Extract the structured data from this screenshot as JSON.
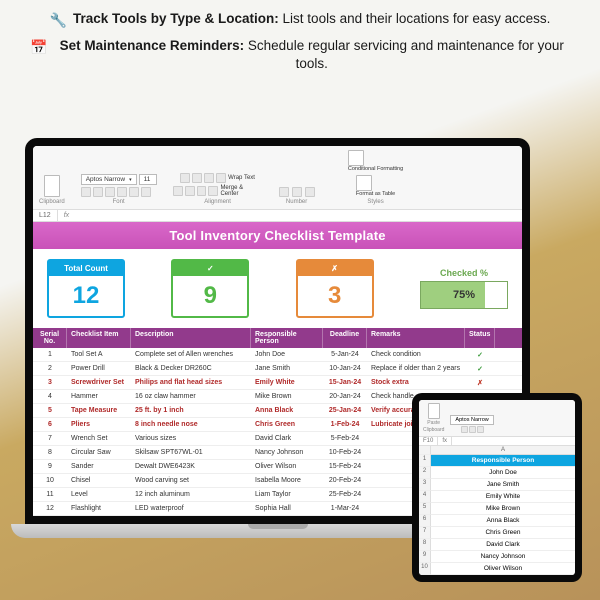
{
  "promo": {
    "line1_bold": "Track Tools by Type & Location:",
    "line1_rest": "List tools and their locations for easy access.",
    "line2_bold": "Set Maintenance Reminders:",
    "line2_rest": "Schedule regular servicing and maintenance for your tools."
  },
  "ribbon": {
    "font_name": "Aptos Narrow",
    "font_size": "11",
    "groups": {
      "clipboard": "Clipboard",
      "font": "Font",
      "alignment": "Alignment",
      "number": "Number",
      "styles": "Styles"
    },
    "wrap_text": "Wrap Text",
    "merge_center": "Merge & Center",
    "cond_fmt": "Conditional Formatting",
    "fmt_table": "Format as Table"
  },
  "cellref": {
    "cell": "L12",
    "fx": "fx"
  },
  "sheet": {
    "title": "Tool Inventory Checklist Template",
    "stats": {
      "total_label": "Total Count",
      "total_value": "12",
      "checked_mark": "✓",
      "checked_value": "9",
      "unchecked_mark": "✗",
      "unchecked_value": "3",
      "pct_label": "Checked %",
      "pct_value": "75%",
      "pct_fill": 75
    },
    "columns": {
      "serial": "Serial No.",
      "item": "Checklist Item",
      "desc": "Description",
      "person": "Responsible Person",
      "deadline": "Deadline",
      "remarks": "Remarks",
      "status": "Status"
    },
    "rows": [
      {
        "n": "1",
        "item": "Tool Set A",
        "desc": "Complete set of Allen wrenches",
        "person": "John Doe",
        "dead": "5-Jan-24",
        "rem": "Check condition",
        "stat": "✓",
        "red": false,
        "ok": true
      },
      {
        "n": "2",
        "item": "Power Drill",
        "desc": "Black & Decker DR260C",
        "person": "Jane Smith",
        "dead": "10-Jan-24",
        "rem": "Replace if older than 2 years",
        "stat": "✓",
        "red": false,
        "ok": true
      },
      {
        "n": "3",
        "item": "Screwdriver Set",
        "desc": "Philips and flat head sizes",
        "person": "Emily White",
        "dead": "15-Jan-24",
        "rem": "Stock extra",
        "stat": "✗",
        "red": true,
        "ok": false
      },
      {
        "n": "4",
        "item": "Hammer",
        "desc": "16 oz claw hammer",
        "person": "Mike Brown",
        "dead": "20-Jan-24",
        "rem": "Check handle",
        "stat": "✓",
        "red": false,
        "ok": true
      },
      {
        "n": "5",
        "item": "Tape Measure",
        "desc": "25 ft. by 1 inch",
        "person": "Anna Black",
        "dead": "25-Jan-24",
        "rem": "Verify accuracy",
        "stat": "✗",
        "red": true,
        "ok": false
      },
      {
        "n": "6",
        "item": "Pliers",
        "desc": "8 inch needle nose",
        "person": "Chris Green",
        "dead": "1-Feb-24",
        "rem": "Lubricate joints",
        "stat": "✗",
        "red": true,
        "ok": false
      },
      {
        "n": "7",
        "item": "Wrench Set",
        "desc": "Various sizes",
        "person": "David Clark",
        "dead": "5-Feb-24",
        "rem": "",
        "stat": "✓",
        "red": false,
        "ok": true
      },
      {
        "n": "8",
        "item": "Circular Saw",
        "desc": "Skilsaw SPT67WL-01",
        "person": "Nancy Johnson",
        "dead": "10-Feb-24",
        "rem": "",
        "stat": "✓",
        "red": false,
        "ok": true
      },
      {
        "n": "9",
        "item": "Sander",
        "desc": "Dewalt DWE6423K",
        "person": "Oliver Wilson",
        "dead": "15-Feb-24",
        "rem": "",
        "stat": "✓",
        "red": false,
        "ok": true
      },
      {
        "n": "10",
        "item": "Chisel",
        "desc": "Wood carving set",
        "person": "Isabella Moore",
        "dead": "20-Feb-24",
        "rem": "",
        "stat": "✓",
        "red": false,
        "ok": true
      },
      {
        "n": "11",
        "item": "Level",
        "desc": "12 inch aluminum",
        "person": "Liam Taylor",
        "dead": "25-Feb-24",
        "rem": "",
        "stat": "✓",
        "red": false,
        "ok": true
      },
      {
        "n": "12",
        "item": "Flashlight",
        "desc": "LED waterproof",
        "person": "Sophia Hall",
        "dead": "1-Mar-24",
        "rem": "",
        "stat": "✓",
        "red": false,
        "ok": true
      }
    ]
  },
  "tablet": {
    "ribbon": {
      "font_name": "Aptos Narrow",
      "clipboard": "Clipboard",
      "paste": "Paste"
    },
    "cellref": {
      "cell": "F10",
      "fx": "fx"
    },
    "col_letter": "A",
    "header": "Responsible Person",
    "rows": [
      "John Doe",
      "Jane Smith",
      "Emily White",
      "Mike Brown",
      "Anna Black",
      "Chris Green",
      "David Clark",
      "Nancy Johnson",
      "Oliver Wilson"
    ]
  }
}
